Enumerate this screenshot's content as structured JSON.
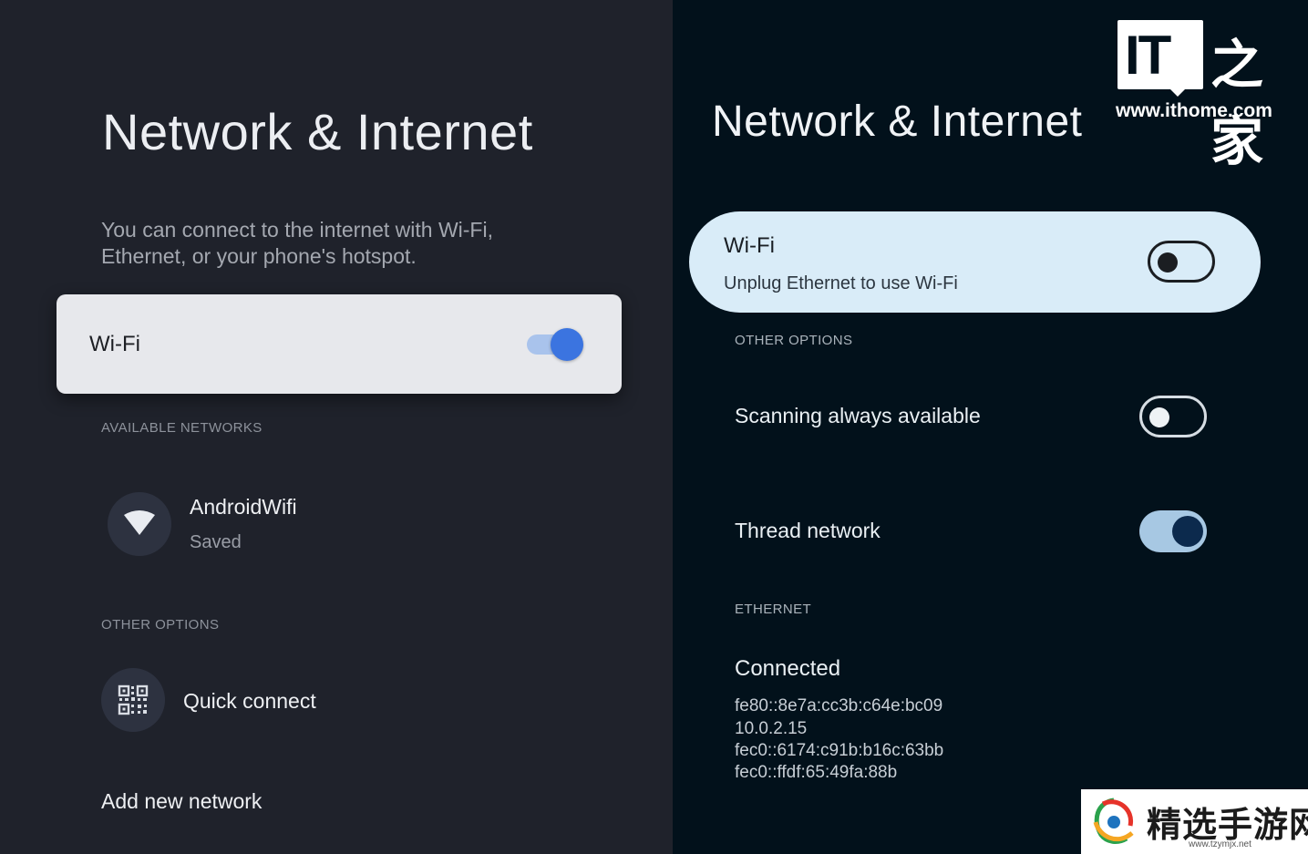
{
  "left": {
    "title": "Network & Internet",
    "description_line1": "You can connect to the internet with Wi-Fi,",
    "description_line2": "Ethernet, or your phone's hotspot.",
    "wifi": {
      "label": "Wi-Fi",
      "enabled": true
    },
    "available_networks_header": "AVAILABLE NETWORKS",
    "networks": [
      {
        "name": "AndroidWifi",
        "status": "Saved",
        "icon": "wifi-signal-icon"
      }
    ],
    "other_options_header": "OTHER OPTIONS",
    "quick_connect": {
      "label": "Quick connect",
      "icon": "qr-code-icon"
    },
    "add_network_label": "Add new network"
  },
  "right": {
    "title": "Network & Internet",
    "wifi": {
      "label": "Wi-Fi",
      "subtitle": "Unplug Ethernet to use Wi-Fi",
      "enabled": false
    },
    "other_options_header": "OTHER OPTIONS",
    "scanning": {
      "label": "Scanning always available",
      "enabled": false
    },
    "thread": {
      "label": "Thread network",
      "enabled": true
    },
    "ethernet_header": "ETHERNET",
    "ethernet_status": "Connected",
    "addresses": [
      "fe80::8e7a:cc3b:c64e:bc09",
      "10.0.2.15",
      "fec0::6174:c91b:b16c:63bb",
      "fec0::ffdf:65:49fa:88b"
    ]
  },
  "watermarks": {
    "ithome_logo_text": "IT",
    "ithome_logo_cn": "之家",
    "ithome_url": "www.ithome.com",
    "jingxuan_text": "精选手游网",
    "jingxuan_url": "www.tzymjx.net"
  },
  "colors": {
    "left_bg": "#1f222b",
    "right_bg": "#02111b",
    "left_toggle_accent": "#3b74e0",
    "right_card_bg": "#d9ecf8",
    "right_toggle_thumb": "#0c2a4d"
  }
}
